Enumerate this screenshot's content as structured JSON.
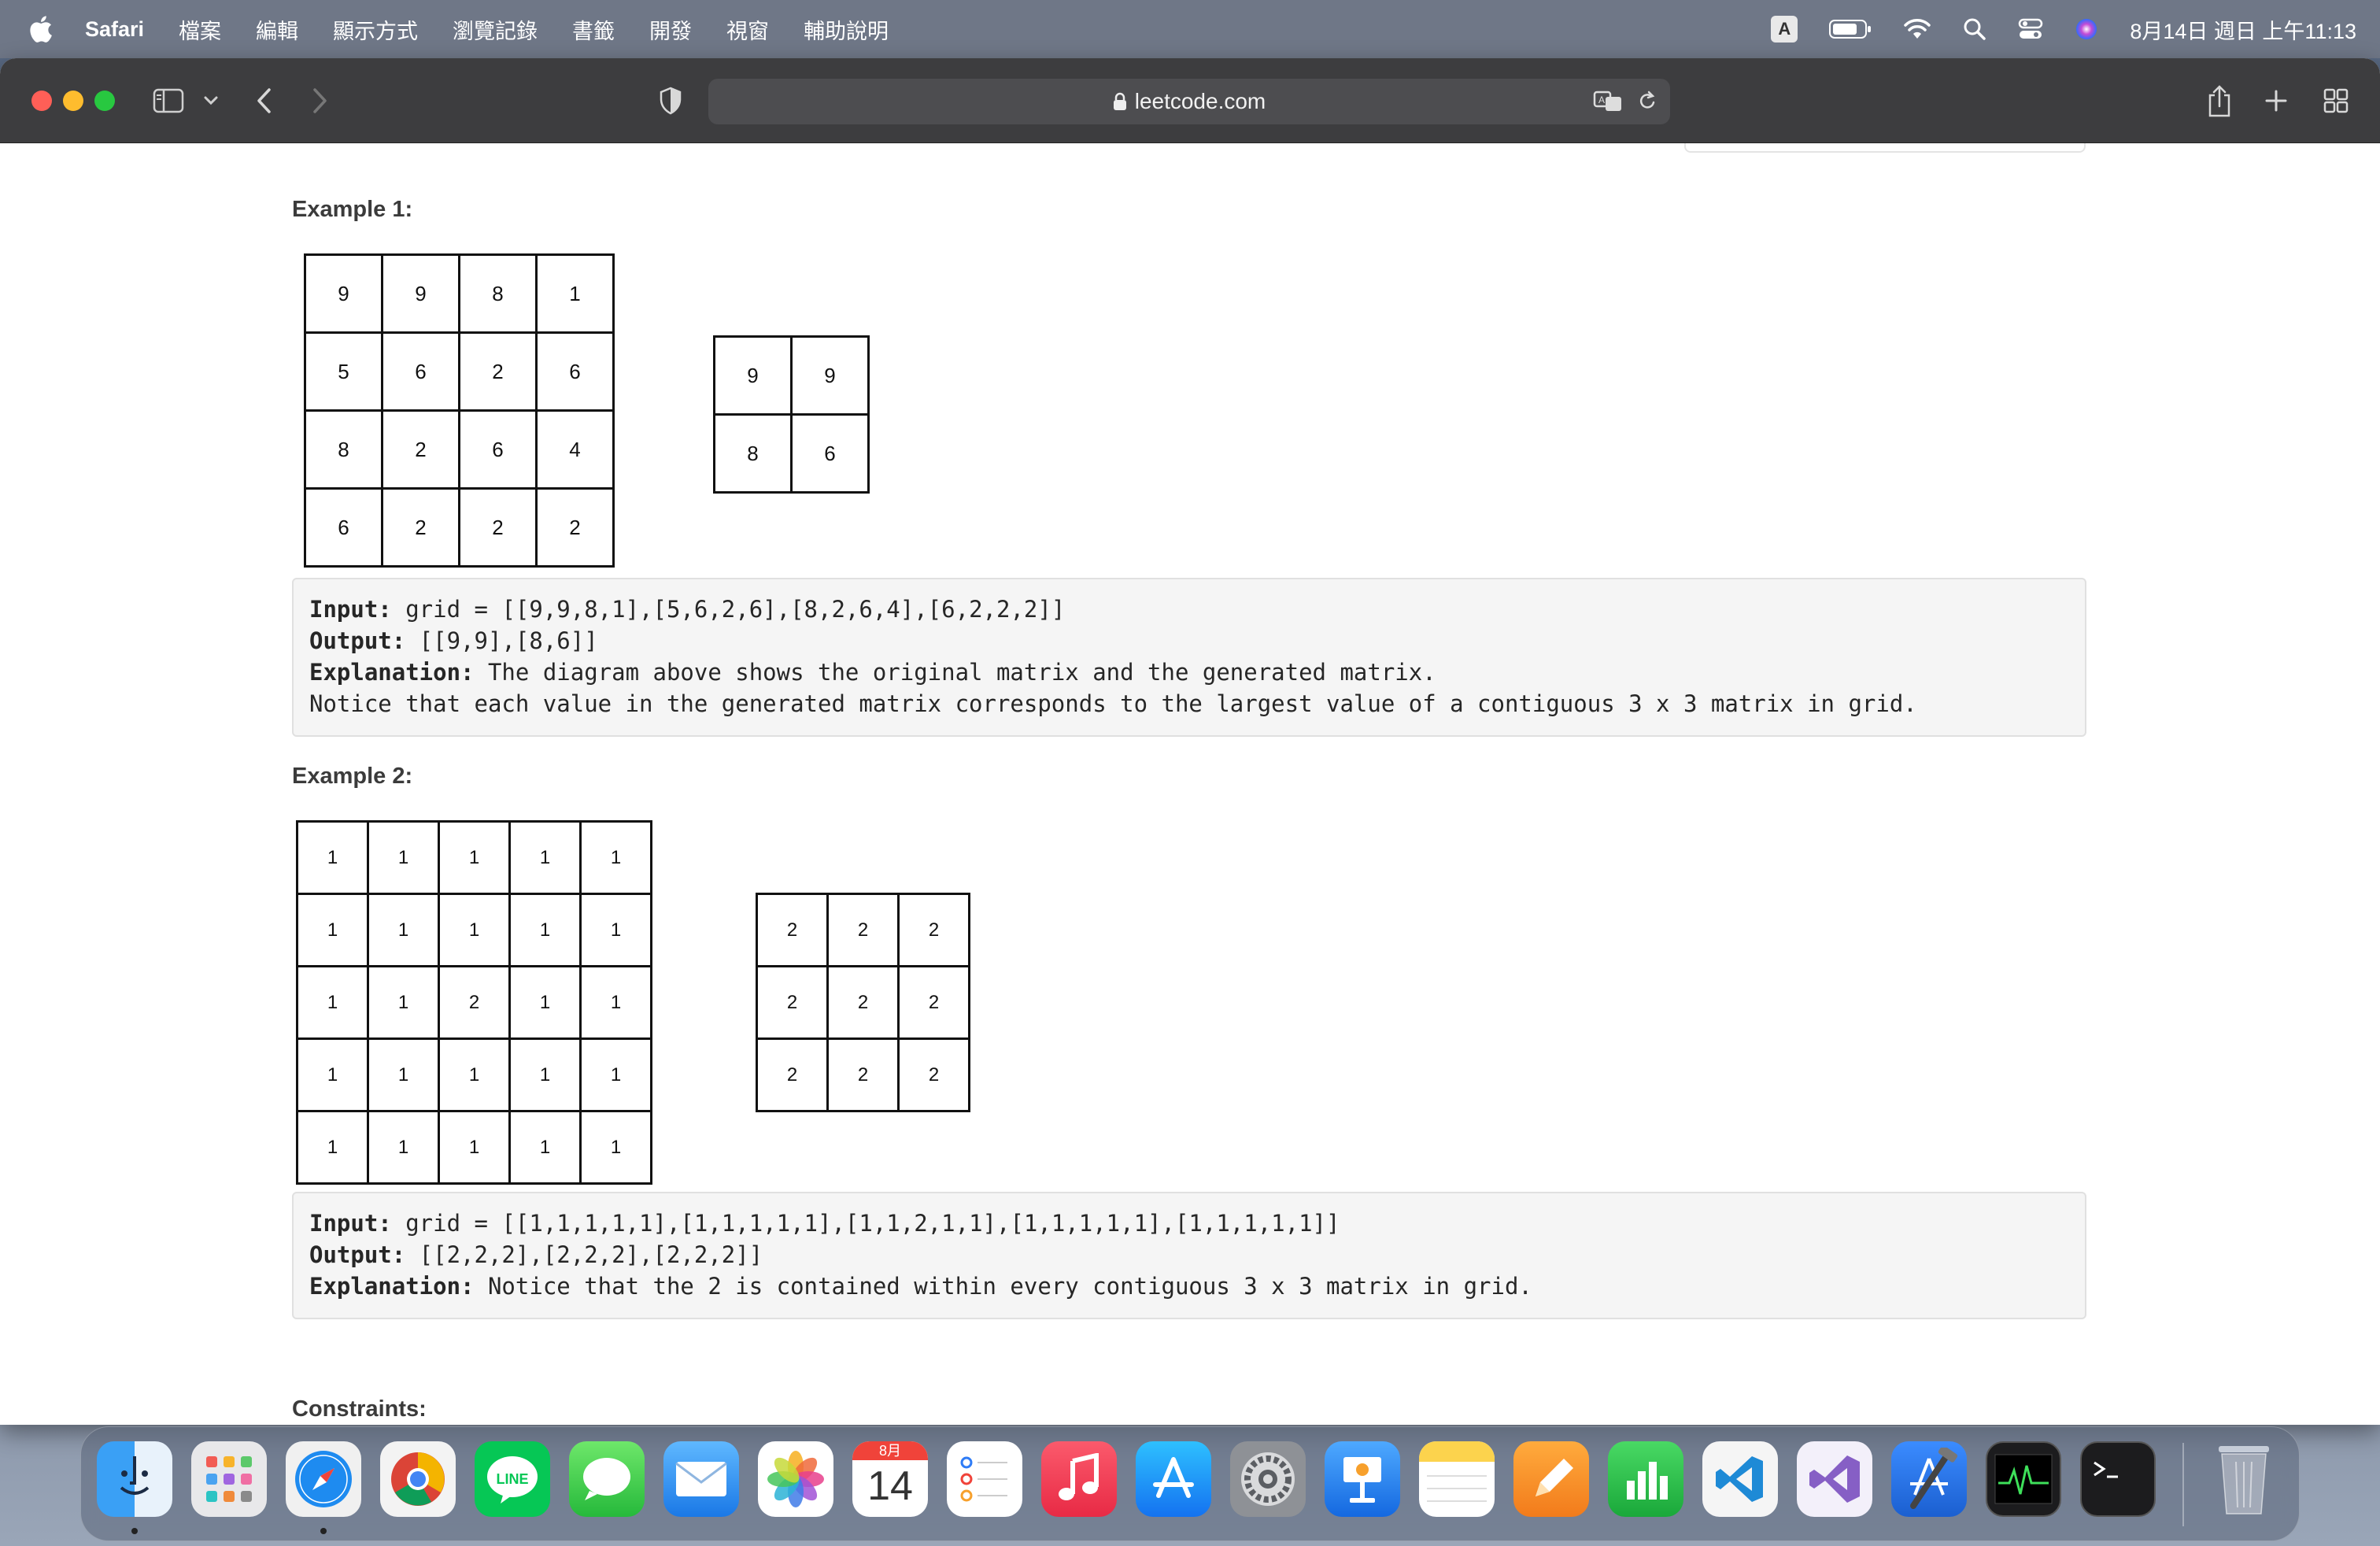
{
  "menubar": {
    "app_name": "Safari",
    "items": [
      "檔案",
      "編輯",
      "顯示方式",
      "瀏覽記錄",
      "書籤",
      "開發",
      "視窗",
      "輔助說明"
    ],
    "input_source": "A",
    "clock": "8月14日 週日 上午11:13"
  },
  "browser": {
    "url": "leetcode.com"
  },
  "examples": [
    {
      "title": "Example 1:",
      "input_grid": [
        [
          9,
          9,
          8,
          1
        ],
        [
          5,
          6,
          2,
          6
        ],
        [
          8,
          2,
          6,
          4
        ],
        [
          6,
          2,
          2,
          2
        ]
      ],
      "output_grid": [
        [
          9,
          9
        ],
        [
          8,
          6
        ]
      ],
      "input_label": "Input:",
      "input_text": " grid = [[9,9,8,1],[5,6,2,6],[8,2,6,4],[6,2,2,2]]",
      "output_label": "Output:",
      "output_text": " [[9,9],[8,6]]",
      "explanation_label": "Explanation:",
      "explanation_text": " The diagram above shows the original matrix and the generated matrix.",
      "extra_line": "Notice that each value in the generated matrix corresponds to the largest value of a contiguous 3 x 3 matrix in grid."
    },
    {
      "title": "Example 2:",
      "input_grid": [
        [
          1,
          1,
          1,
          1,
          1
        ],
        [
          1,
          1,
          1,
          1,
          1
        ],
        [
          1,
          1,
          2,
          1,
          1
        ],
        [
          1,
          1,
          1,
          1,
          1
        ],
        [
          1,
          1,
          1,
          1,
          1
        ]
      ],
      "output_grid": [
        [
          2,
          2,
          2
        ],
        [
          2,
          2,
          2
        ],
        [
          2,
          2,
          2
        ]
      ],
      "input_label": "Input:",
      "input_text": " grid = [[1,1,1,1,1],[1,1,1,1,1],[1,1,2,1,1],[1,1,1,1,1],[1,1,1,1,1]]",
      "output_label": "Output:",
      "output_text": " [[2,2,2],[2,2,2],[2,2,2]]",
      "explanation_label": "Explanation:",
      "explanation_text": " Notice that the 2 is contained within every contiguous 3 x 3 matrix in grid."
    }
  ],
  "constraints_title": "Constraints:",
  "dock": {
    "calendar_month": "8月",
    "calendar_day": "14",
    "line_label": "LINE",
    "apps": [
      "finder-icon",
      "launchpad-icon",
      "safari-icon",
      "chrome-icon",
      "line-icon",
      "messages-icon",
      "mail-icon",
      "photos-icon",
      "calendar-icon",
      "reminders-icon",
      "music-icon",
      "app-store-icon",
      "system-preferences-icon",
      "keynote-icon",
      "notes-icon",
      "pages-icon",
      "numbers-icon",
      "vscode-icon",
      "visual-studio-icon",
      "xcode-icon",
      "activity-monitor-icon",
      "terminal-icon",
      "trash-icon"
    ]
  },
  "colors": {
    "menubar_bg": "#6f7787",
    "toolbar_bg": "#3d3d3f",
    "codebox_bg": "#f5f5f5"
  }
}
